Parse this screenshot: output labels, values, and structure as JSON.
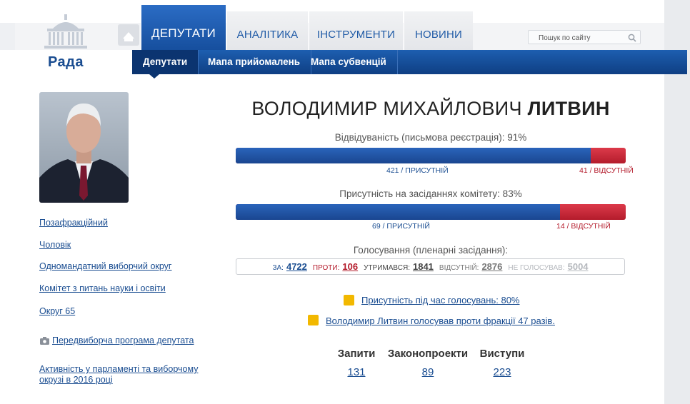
{
  "logo": {
    "label": "Рада"
  },
  "tabs": [
    {
      "label": "ДЕПУТАТИ"
    },
    {
      "label": "АНАЛІТИКА"
    },
    {
      "label": "ІНСТРУМЕНТИ"
    },
    {
      "label": "НОВИНИ"
    }
  ],
  "search": {
    "placeholder": "Пошук по сайту"
  },
  "subnav": [
    {
      "label": "Депутати"
    },
    {
      "label": "Мапа прийомалень"
    },
    {
      "label": "Мапа субвенцій"
    }
  ],
  "sidebar": {
    "links": [
      "Позафракційний",
      "Чоловік",
      "Одномандатний виборчий округ",
      "Комітет з питань науки і освіти",
      "Округ 65"
    ],
    "program_link": "Передвиборча програма депутата",
    "activity_link": "Активність у парламенті та виборчому окрузі в 2016 році"
  },
  "deputy": {
    "name_first": "ВОЛОДИМИР МИХАЙЛОВИЧ",
    "name_last": "ЛИТВИН"
  },
  "attendance": {
    "title": "Відвідуваність (письмова реєстрація): 91%",
    "fraction": 0.911,
    "present_label": "421 / присутній",
    "absent_label": "41 / відсутній"
  },
  "committee": {
    "title": "Присутність на засіданнях комітету: 83%",
    "fraction": 0.831,
    "present_label": "69 / присутній",
    "absent_label": "14 / відсутній"
  },
  "voting": {
    "title": "Голосування (пленарні засідання):",
    "items": [
      {
        "label": "ЗА:",
        "value": "4722",
        "color": "#1a4d91"
      },
      {
        "label": "ПРОТИ:",
        "value": "106",
        "color": "#b41c2c"
      },
      {
        "label": "УТРИМАВСЯ:",
        "value": "1841",
        "color": "#444444"
      },
      {
        "label": "ВІДСУТНІЙ:",
        "value": "2876",
        "color": "#777777"
      },
      {
        "label": "НЕ ГОЛОСУВАВ:",
        "value": "5004",
        "color": "#b5b8bd"
      }
    ]
  },
  "info_links": [
    "Присутність під час голосувань: 80%",
    "Володимир Литвин голосував проти фракції 47 разів."
  ],
  "summary": [
    {
      "label": "Запити",
      "value": "131"
    },
    {
      "label": "Законопроекти",
      "value": "89"
    },
    {
      "label": "Виступи",
      "value": "223"
    }
  ],
  "colors": {
    "accent_blue": "#1a4d91",
    "accent_red": "#b41c2c",
    "warning_yellow": "#f2b800"
  },
  "icons": [
    "parliament-logo-icon",
    "home-icon",
    "search-icon",
    "camera-icon",
    "hand-vote-icon"
  ]
}
